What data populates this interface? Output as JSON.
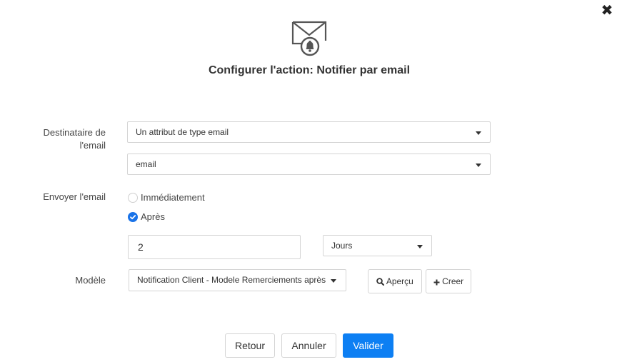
{
  "dialog": {
    "title": "Configurer l'action: Notifier par email",
    "close_icon": "close-icon",
    "header_icon": "email-bell-icon"
  },
  "recipient": {
    "label_line1": "Destinataire de",
    "label_line2": "l'email",
    "type_select": "Un attribut de type email",
    "attribute_select": "email"
  },
  "send": {
    "label": "Envoyer l'email",
    "option_immediate": "Immédiatement",
    "option_after": "Après",
    "selected": "Après",
    "delay_value": "2",
    "unit_select": "Jours"
  },
  "template": {
    "label": "Modèle",
    "select_value": "Notification Client - Modele Remerciements après",
    "preview_label": "Aperçu",
    "create_label": "Creer"
  },
  "footer": {
    "back_label": "Retour",
    "cancel_label": "Annuler",
    "submit_label": "Valider"
  },
  "colors": {
    "primary": "#0d7ff3",
    "radio_checked": "#1a73e8"
  }
}
